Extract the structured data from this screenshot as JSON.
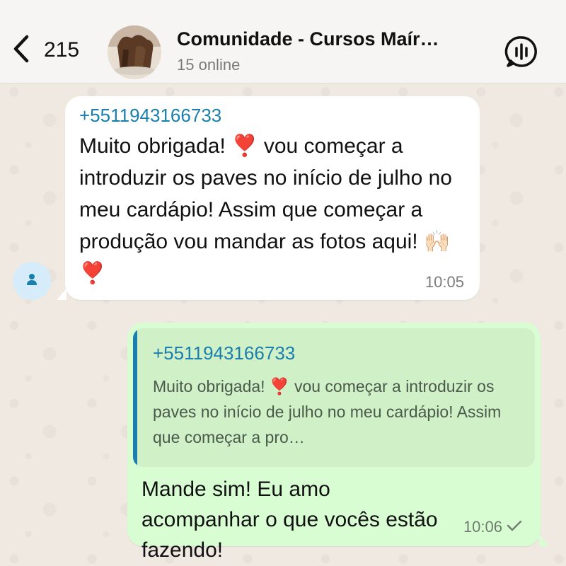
{
  "header": {
    "back_count": "215",
    "group_title": "Comunidade - Cursos Maír…",
    "online_status": "15 online"
  },
  "messages": {
    "incoming": {
      "sender": "+5511943166733",
      "text": "Muito obrigada! ❣️ vou começar a introduzir os paves no início de julho no meu cardápio! Assim que começar a produção vou mandar as fotos aqui! 🙌🏻 ❣️",
      "time": "10:05"
    },
    "outgoing": {
      "quote_sender": "+5511943166733",
      "quote_text": "Muito obrigada! ❣️ vou começar a introduzir os paves no início de julho no meu cardápio! Assim que começar a pro…",
      "text": "Mande sim! Eu amo acompanhar o que vocês estão fazendo!",
      "time": "10:06"
    }
  },
  "icons": {
    "back": "chevron-left-icon",
    "voice": "voice-chat-icon",
    "sender": "person-icon",
    "status": "single-check-icon"
  },
  "colors": {
    "sender_name": "#1a7fae",
    "outgoing_bubble": "#d9fdd3",
    "incoming_bubble": "#ffffff"
  }
}
